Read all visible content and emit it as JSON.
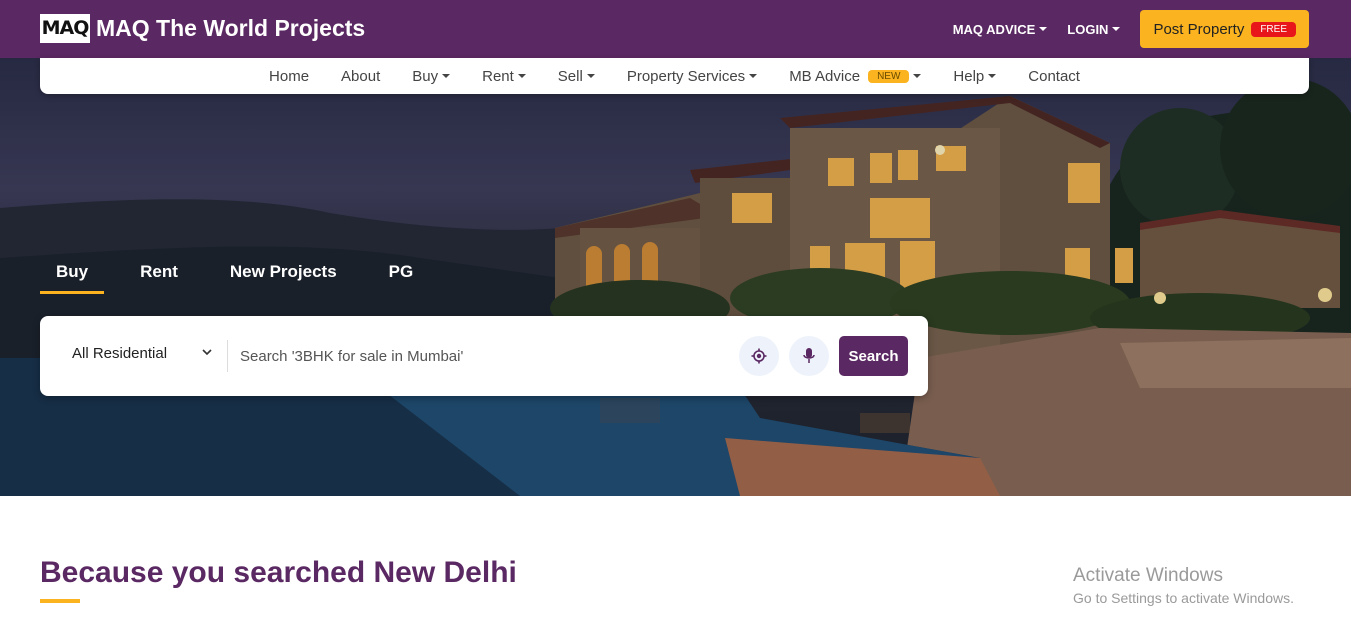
{
  "brand": {
    "logo": "MAQ",
    "name": "MAQ The World Projects"
  },
  "topnav": {
    "advice": "MAQ ADVICE",
    "login": "LOGIN",
    "post_property": "Post Property",
    "free_badge": "FREE"
  },
  "mainnav": {
    "items": [
      {
        "label": "Home",
        "dropdown": false
      },
      {
        "label": "About",
        "dropdown": false
      },
      {
        "label": "Buy",
        "dropdown": true
      },
      {
        "label": "Rent",
        "dropdown": true
      },
      {
        "label": "Sell",
        "dropdown": true
      },
      {
        "label": "Property Services",
        "dropdown": true
      },
      {
        "label": "MB Advice",
        "dropdown": true,
        "badge": "NEW"
      },
      {
        "label": "Help",
        "dropdown": true
      },
      {
        "label": "Contact",
        "dropdown": false
      }
    ]
  },
  "search_tabs": [
    {
      "label": "Buy",
      "active": true
    },
    {
      "label": "Rent",
      "active": false
    },
    {
      "label": "New Projects",
      "active": false
    },
    {
      "label": "PG",
      "active": false
    }
  ],
  "search": {
    "property_type": "All Residential",
    "placeholder": "Search '3BHK for sale in Mumbai'",
    "button": "Search",
    "locate_icon": "crosshair-icon",
    "voice_icon": "microphone-icon"
  },
  "section": {
    "title": "Because you searched New Delhi"
  },
  "watermark": {
    "title": "Activate Windows",
    "subtitle": "Go to Settings to activate Windows."
  },
  "colors": {
    "brand": "#5a2862",
    "accent": "#fbb41f",
    "badge_red": "#e8151b"
  }
}
